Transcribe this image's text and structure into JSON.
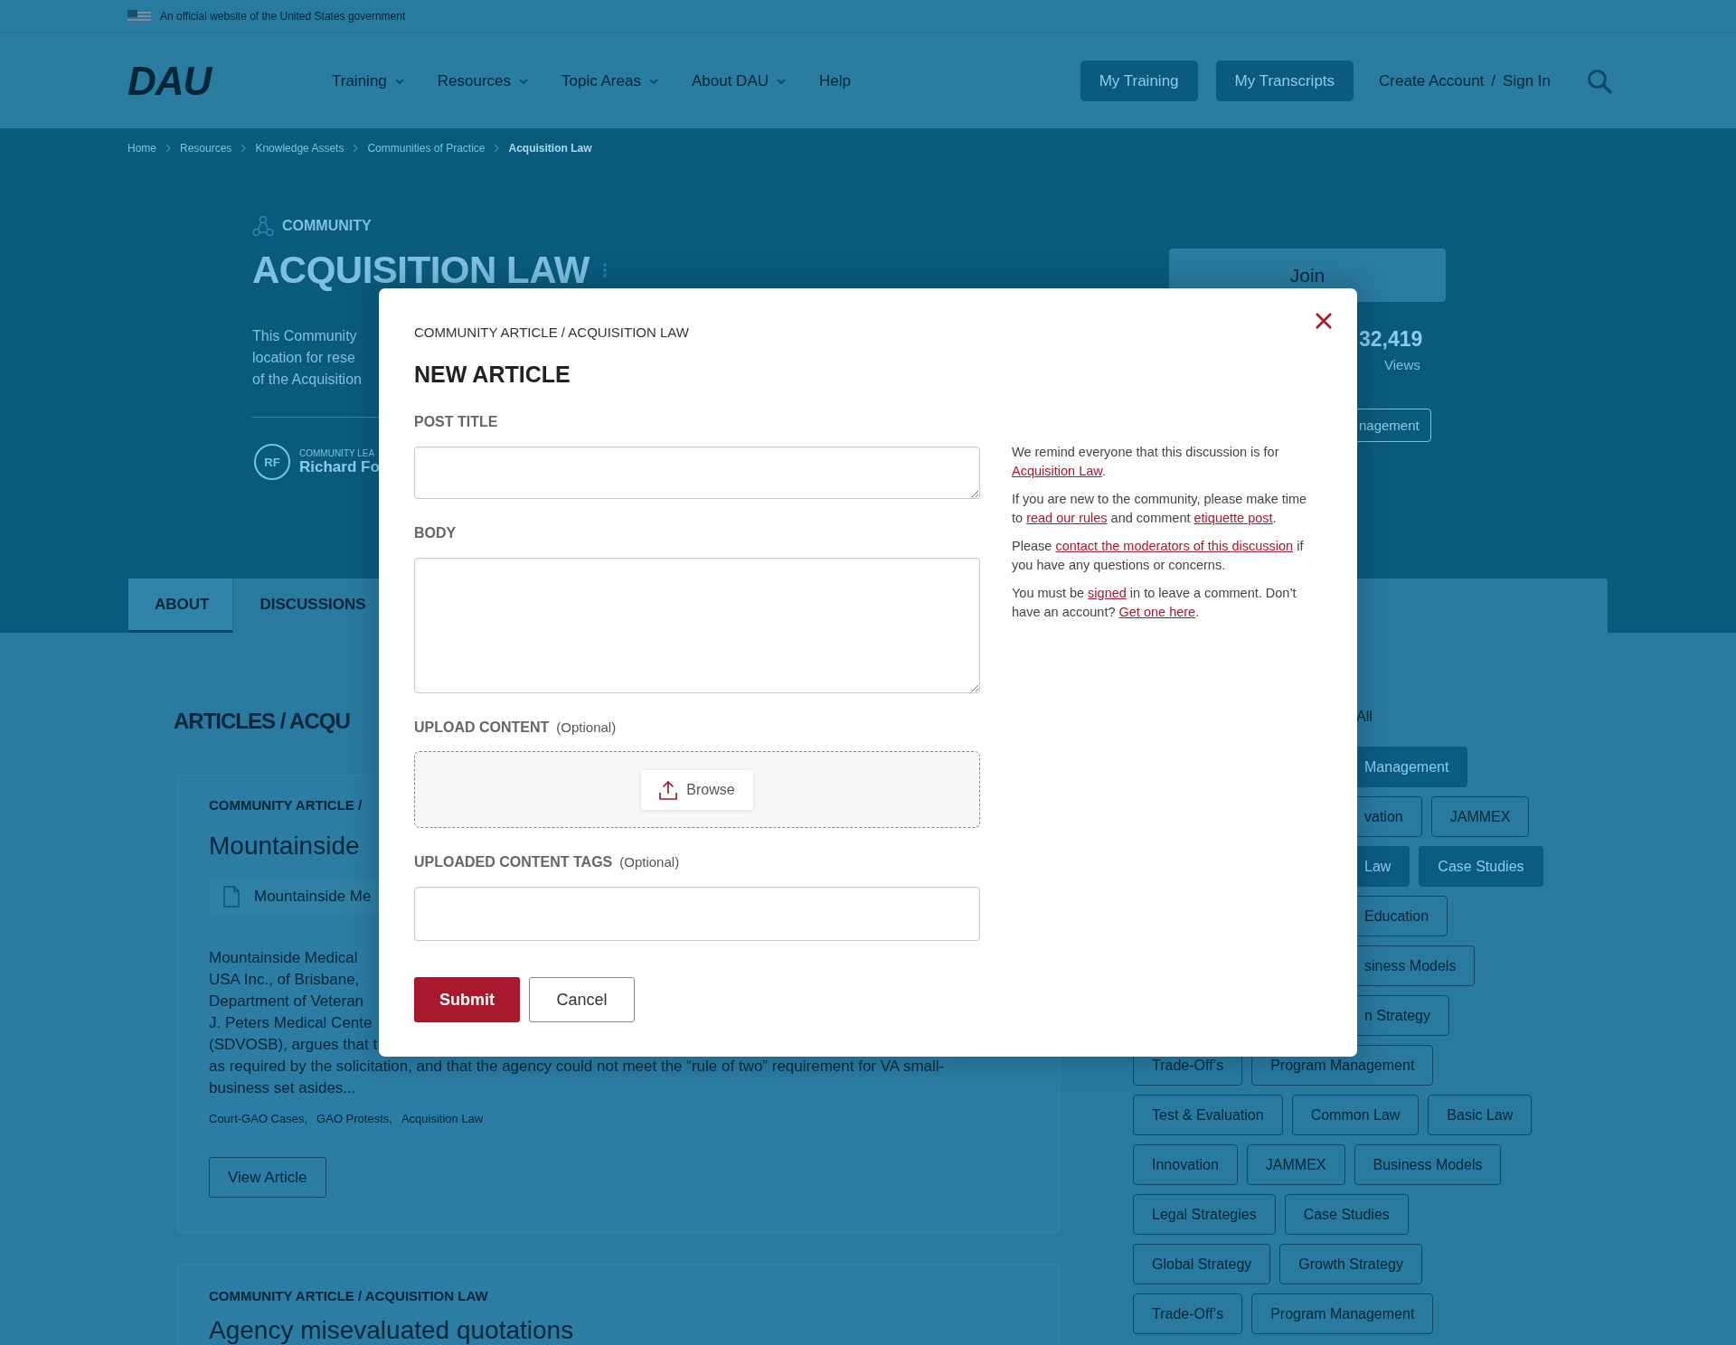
{
  "gov_banner": {
    "text": "An official website of the United States government"
  },
  "header": {
    "logo": "DAU",
    "nav": [
      {
        "label": "Training",
        "has_menu": true
      },
      {
        "label": "Resources",
        "has_menu": true
      },
      {
        "label": "Topic Areas",
        "has_menu": true
      },
      {
        "label": "About DAU",
        "has_menu": true
      },
      {
        "label": "Help",
        "has_menu": false
      }
    ],
    "buttons": [
      "My Training",
      "My Transcripts"
    ],
    "account_links": [
      "Create Account",
      "Sign In"
    ],
    "separator": "/"
  },
  "breadcrumb": [
    {
      "label": "Home",
      "current": false
    },
    {
      "label": "Resources",
      "current": false
    },
    {
      "label": "Knowledge Assets",
      "current": false
    },
    {
      "label": "Communities of Practice",
      "current": false
    },
    {
      "label": "Acquisition Law",
      "current": true
    }
  ],
  "hero": {
    "kicker": "COMMUNITY",
    "title": "ACQUISITION LAW",
    "description": [
      "This Community",
      "location for rese",
      "of the Acquisition"
    ],
    "leader": {
      "initials": "RF",
      "role": "COMMUNITY LEA",
      "name": "Richard Fo"
    },
    "join_button": "Join",
    "stat_value": "32,419",
    "stat_label": "Views",
    "tags": [
      "nagement"
    ]
  },
  "tabs": [
    {
      "label": "ABOUT",
      "selected": true
    },
    {
      "label": "DISCUSSIONS",
      "selected": false
    }
  ],
  "articles": {
    "heading": "ARTICLES / ACQU",
    "cards": [
      {
        "kicker": "COMMUNITY ARTICLE /",
        "title": "Mountainside",
        "attachment": "Mountainside Me",
        "lines": [
          "Mountainside Medical",
          "USA Inc., of Brisbane,",
          "Department of Veteran",
          "J. Peters Medical Cente",
          "(SDVOSB), argues that t",
          "as required by the solicitation, and that the agency could not meet the “rule of two” requirement for VA small-",
          "business set asides..."
        ],
        "tags": [
          "Court-GAO Cases,",
          "GAO Protests,",
          "Acquisition Law"
        ],
        "button": "View Article"
      },
      {
        "kicker": "COMMUNITY ARTICLE / ACQUISITION LAW",
        "title": "Agency misevaluated quotations"
      }
    ]
  },
  "filter": {
    "label": "All",
    "rows": [
      {
        "kind": "clipped",
        "tags": [
          {
            "label": "Management",
            "selected": true
          }
        ]
      },
      {
        "kind": "clipped",
        "tags": [
          {
            "label": "vation",
            "selected": false
          },
          {
            "label": "JAMMEX",
            "selected": false
          }
        ]
      },
      {
        "kind": "clipped",
        "tags": [
          {
            "label": "Law",
            "selected": true
          },
          {
            "label": "Case Studies",
            "selected": true
          }
        ]
      },
      {
        "kind": "clipped",
        "tags": [
          {
            "label": "Education",
            "selected": false
          }
        ]
      },
      {
        "kind": "clipped",
        "tags": [
          {
            "label": "siness Models",
            "selected": false
          }
        ]
      },
      {
        "kind": "clipped",
        "tags": [
          {
            "label": "n Strategy",
            "selected": false
          }
        ]
      },
      {
        "kind": "full",
        "tags": [
          {
            "label": "Trade-Off’s",
            "selected": false
          },
          {
            "label": "Program Management",
            "selected": false
          }
        ]
      },
      {
        "kind": "full",
        "tags": [
          {
            "label": "Test & Evaluation",
            "selected": false
          },
          {
            "label": "Common Law",
            "selected": false
          },
          {
            "label": "Basic Law",
            "selected": false
          }
        ]
      },
      {
        "kind": "full",
        "tags": [
          {
            "label": "Innovation",
            "selected": false
          },
          {
            "label": "JAMMEX",
            "selected": false
          },
          {
            "label": "Business Models",
            "selected": false
          }
        ]
      },
      {
        "kind": "full",
        "tags": [
          {
            "label": "Legal Strategies",
            "selected": false
          },
          {
            "label": "Case Studies",
            "selected": false
          }
        ]
      },
      {
        "kind": "full",
        "tags": [
          {
            "label": "Global Strategy",
            "selected": false
          },
          {
            "label": "Growth Strategy",
            "selected": false
          }
        ]
      },
      {
        "kind": "full",
        "tags": [
          {
            "label": "Trade-Off’s",
            "selected": false
          },
          {
            "label": "Program Management",
            "selected": false
          }
        ]
      }
    ]
  },
  "dialog": {
    "breadcrumb": "COMMUNITY ARTICLE / ACQUISITION LAW",
    "title": "NEW ARTICLE",
    "fields": [
      {
        "kind": "short_area",
        "label": "POST TITLE"
      },
      {
        "kind": "area",
        "label": "BODY"
      },
      {
        "kind": "upload",
        "label": "UPLOAD CONTENT",
        "note": "(Optional)",
        "button": "Browse"
      },
      {
        "kind": "input",
        "label": "UPLOADED CONTENT TAGS",
        "note": "(Optional)"
      }
    ],
    "buttons": [
      {
        "label": "Submit",
        "kind": "primary"
      },
      {
        "label": "Cancel",
        "kind": "secondary"
      }
    ],
    "notices": [
      [
        {
          "text": "We remind everyone that this discussion is for "
        },
        {
          "text": "Acquisition Law",
          "link": true
        },
        {
          "text": "."
        }
      ],
      [
        {
          "text": "If you are new to the community, please make time to "
        },
        {
          "text": "read our rules",
          "link": true
        },
        {
          "text": " and comment "
        },
        {
          "text": "etiquette post",
          "link": true
        },
        {
          "text": "."
        }
      ],
      [
        {
          "text": "Please "
        },
        {
          "text": "contact the moderators of this discussion",
          "link": true
        },
        {
          "text": " if you have any questions or concerns."
        }
      ],
      [
        {
          "text": "You must be "
        },
        {
          "text": "signed",
          "link": true
        },
        {
          "text": " in to leave a comment. Don’t have an account? "
        },
        {
          "text": "Get one here",
          "link": true
        },
        {
          "text": "."
        }
      ]
    ]
  }
}
